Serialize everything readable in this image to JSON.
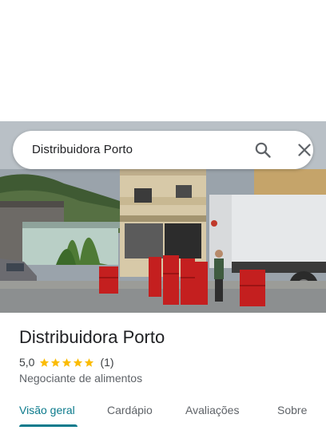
{
  "search": {
    "query": "Distribuidora Porto"
  },
  "place": {
    "name": "Distribuidora Porto",
    "rating": "5,0",
    "review_count": "(1)",
    "stars": 5,
    "category": "Negociante de alimentos"
  },
  "tabs": [
    {
      "label": "Visão geral",
      "active": true
    },
    {
      "label": "Cardápio",
      "active": false
    },
    {
      "label": "Avaliações",
      "active": false
    },
    {
      "label": "Sobre",
      "active": false
    }
  ],
  "colors": {
    "accent": "#0b7a8c",
    "star": "#fbbc04"
  }
}
